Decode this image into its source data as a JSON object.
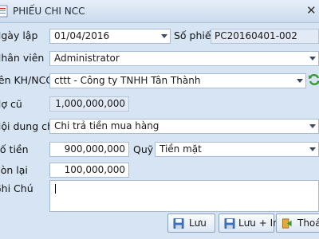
{
  "window": {
    "title": "PHIẾU CHI NCC",
    "close": "✕"
  },
  "form": {
    "ngay_lap": {
      "label": "Ngày lập",
      "value": "01/04/2016"
    },
    "so_phieu": {
      "label": "Số phiếu",
      "value": "PC20160401-002"
    },
    "nhan_vien": {
      "label": "Nhân viên",
      "value": "Administrator"
    },
    "ten_khncc": {
      "label": "Tên KH/NCC",
      "value": "cttt - Công ty TNHH Tân Thành"
    },
    "no_cu": {
      "label": "Nợ cũ",
      "value": "1,000,000,000"
    },
    "noi_dung_chi": {
      "label": "Nội dung chi",
      "value": "Chi trả tiền mua hàng"
    },
    "so_tien": {
      "label": "Số tiền",
      "value": "900,000,000"
    },
    "quy": {
      "label": "Quỹ",
      "value": "Tiền mặt"
    },
    "con_lai": {
      "label": "Còn lại",
      "value": "100,000,000"
    },
    "ghi_chu": {
      "label": "Ghi Chú",
      "value": ""
    }
  },
  "buttons": {
    "luu": "Lưu",
    "luu_in": "Lưu + In",
    "thoat": "Thoát"
  },
  "icons": {
    "app": "document-icon",
    "refresh": "refresh-icon",
    "save": "save-icon",
    "save_print": "save-print-icon",
    "exit": "exit-icon"
  },
  "colors": {
    "background": "#d6e4f3",
    "field_border": "#a7bcd4",
    "readonly_field": "#e2ebf5",
    "refresh_green": "#3a9a2e"
  }
}
